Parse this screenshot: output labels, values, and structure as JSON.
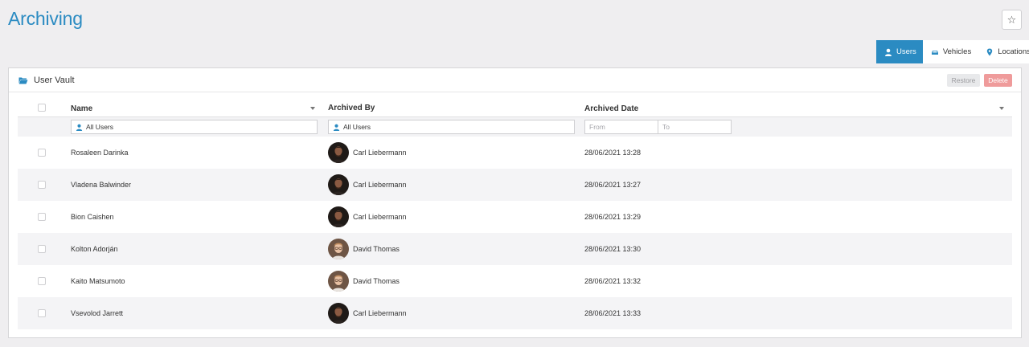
{
  "page": {
    "title": "Archiving"
  },
  "tabs": [
    {
      "label": "Users",
      "icon": "user-icon",
      "active": true
    },
    {
      "label": "Vehicles",
      "icon": "car-icon",
      "active": false
    },
    {
      "label": "Locations",
      "icon": "map-pin-icon",
      "active": false
    }
  ],
  "panel": {
    "title": "User Vault",
    "restore_label": "Restore",
    "delete_label": "Delete"
  },
  "table": {
    "columns": {
      "name": "Name",
      "archived_by": "Archived By",
      "archived_date": "Archived Date"
    },
    "filters": {
      "name": "All Users",
      "archived_by": "All Users",
      "from_placeholder": "From",
      "to_placeholder": "To"
    },
    "rows": [
      {
        "name": "Rosaleen Darinka",
        "archived_by": "Carl Liebermann",
        "date": "28/06/2021 13:28"
      },
      {
        "name": "Vladena Balwinder",
        "archived_by": "Carl Liebermann",
        "date": "28/06/2021 13:27"
      },
      {
        "name": "Bion Caishen",
        "archived_by": "Carl Liebermann",
        "date": "28/06/2021 13:29"
      },
      {
        "name": "Kolton Adorján",
        "archived_by": "David Thomas",
        "date": "28/06/2021 13:30"
      },
      {
        "name": "Kaito Matsumoto",
        "archived_by": "David Thomas",
        "date": "28/06/2021 13:32"
      },
      {
        "name": "Vsevolod Jarrett",
        "archived_by": "Carl Liebermann",
        "date": "28/06/2021 13:33"
      }
    ]
  },
  "colors": {
    "accent": "#2b8bc2",
    "delete": "#ef9b9b",
    "row_alt": "#f4f4f6"
  }
}
